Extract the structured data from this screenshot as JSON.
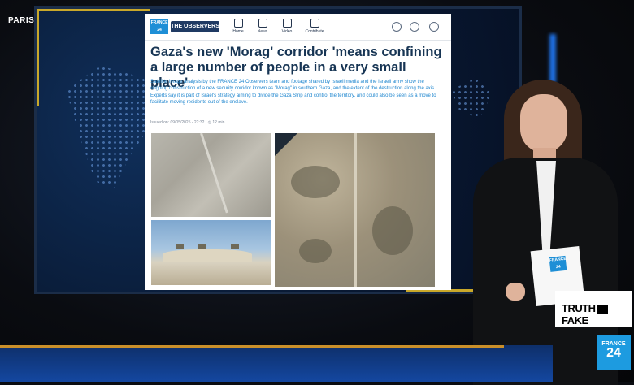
{
  "location": "PARIS",
  "site": {
    "brand_small": "FRANCE 24",
    "brand_observers": "THE OBSERVERS",
    "nav": [
      "Home",
      "News",
      "Video",
      "Contribute"
    ]
  },
  "article": {
    "headline": "Gaza's new 'Morag' corridor 'means confining a large number of people in a very small place'",
    "summary": "Satellite image analysis by the FRANCE 24 Observers team and footage shared by Israeli media and the Israeli army show the ongoing construction of a new security corridor known as \"Morag\" in southern Gaza, and the extent of the destruction along the axis. Experts say it is part of Israel's strategy aiming to divide the Gaza Strip and control the territory, and could also be seen as a move to facilitate moving residents out of the enclave.",
    "date": "Issued on: 09/05/2025 - 22:32",
    "read_time": "12 min"
  },
  "segment": {
    "left": "TRUTH",
    "right": "FAKE"
  },
  "channel_logo": {
    "line1": "FRANCE",
    "line2": "24"
  },
  "colors": {
    "accent_blue": "#1e8fd6",
    "headline": "#173554",
    "frame_gold": "#c9a82a"
  }
}
